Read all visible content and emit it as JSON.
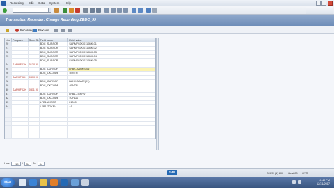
{
  "menubar": {
    "items": [
      "Recording",
      "Edit",
      "Goto",
      "System",
      "Help"
    ]
  },
  "titlebar": {
    "title": "Transaction Recorder: Change Recording ZBDC_99"
  },
  "app_toolbar": {
    "process_label": "Process",
    "recording_label": "Recording"
  },
  "table": {
    "columns": [
      "Line",
      "Program",
      "Screen",
      "St..",
      "Field name",
      "Field value"
    ],
    "rows": [
      {
        "line": "20",
        "program": "",
        "screen": "",
        "start": "",
        "field": "BDC_SUBSCR",
        "value": "SAPMF02K                    0110BK-01"
      },
      {
        "line": "21",
        "program": "",
        "screen": "",
        "start": "",
        "field": "BDC_SUBSCR",
        "value": "SAPMF02K                    0110BK-02"
      },
      {
        "line": "22",
        "program": "",
        "screen": "",
        "start": "",
        "field": "BDC_SUBSCR",
        "value": "SAPMF02K                    0110BK-03"
      },
      {
        "line": "23",
        "program": "",
        "screen": "",
        "start": "",
        "field": "BDC_SUBSCR",
        "value": "SAPMF02K                    0110BK-04"
      },
      {
        "line": "",
        "program": "",
        "screen": "",
        "start": "",
        "field": "BDC_SUBSCR",
        "value": "SAPMF02K                    0110BK-05"
      },
      {
        "line": "24",
        "program": "SAPMF02K",
        "screen": "0130",
        "start": "X",
        "field": "",
        "value": ""
      },
      {
        "line": "25",
        "program": "",
        "screen": "",
        "start": "",
        "field": "BDC_CURSOR",
        "value": "LFBK-BANKS(01)"
      },
      {
        "line": "26",
        "program": "",
        "screen": "",
        "start": "",
        "field": "BDC_OKCODE",
        "value": "=ENTR"
      },
      {
        "line": "27",
        "program": "SAPMF02K",
        "screen": "0310",
        "start": "X",
        "field": "",
        "value": ""
      },
      {
        "line": "28",
        "program": "",
        "screen": "",
        "start": "",
        "field": "BDC_CURSOR",
        "value": "BANK-NAME(01)"
      },
      {
        "line": "29",
        "program": "",
        "screen": "",
        "start": "",
        "field": "BDC_OKCODE",
        "value": "=ENTR"
      },
      {
        "line": "30",
        "program": "SAPMF02K",
        "screen": "0311",
        "start": "X",
        "field": "",
        "value": ""
      },
      {
        "line": "31",
        "program": "",
        "screen": "",
        "start": "",
        "field": "BDC_CURSOR",
        "value": "LFB1-ZGKRV"
      },
      {
        "line": "32",
        "program": "",
        "screen": "",
        "start": "",
        "field": "BDC_OKCODE",
        "value": "=UPDA"
      },
      {
        "line": "33",
        "program": "",
        "screen": "",
        "start": "",
        "field": "LFB1-AKONT",
        "value": "21000"
      },
      {
        "line": "34",
        "program": "",
        "screen": "",
        "start": "",
        "field": "LFB1-ZGKRV",
        "value": "A1"
      }
    ],
    "highlight_row_index": 6
  },
  "status_row": {
    "line_label": "Line",
    "line_value": "19",
    "of_label": "/",
    "of_value": "34",
    "po_label": "Po",
    "po_value": "34"
  },
  "sap_status": {
    "logo": "SAP",
    "system": "SHER (1) 800",
    "server": "ides800",
    "mode": "OVR"
  },
  "taskbar": {
    "start_label": "Start",
    "time": "10:40 PM",
    "date": "12/31/2017"
  }
}
